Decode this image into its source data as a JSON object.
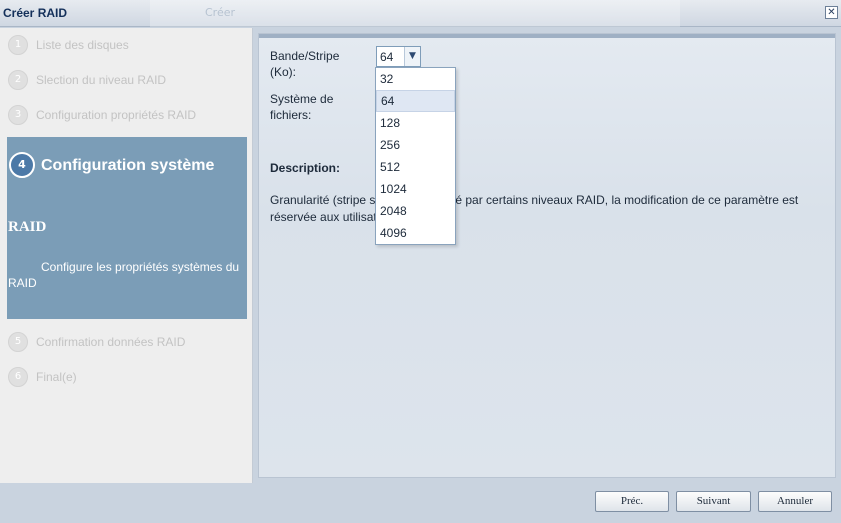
{
  "window": {
    "title": "Créer RAID",
    "background_label": "Créer",
    "close_glyph": "✕"
  },
  "steps": [
    {
      "number": "1",
      "label": "Liste des disques"
    },
    {
      "number": "2",
      "label": "Slection du niveau RAID"
    },
    {
      "number": "3",
      "label": "Configuration propriétés RAID"
    },
    {
      "number": "5",
      "label": "Confirmation données RAID"
    },
    {
      "number": "6",
      "label": "Final(e)"
    }
  ],
  "active_step": {
    "number": "4",
    "label_line1": "Configuration système",
    "label_line2": "RAID",
    "description": "Configure les propriétés systèmes du RAID"
  },
  "form": {
    "stripe_label_line1": "Bande/Stripe",
    "stripe_label_line2": "(Ko):",
    "stripe_value": "64",
    "fs_label_line1": "Système de",
    "fs_label_line2": "fichiers:",
    "stripe_options": [
      "32",
      "64",
      "128",
      "256",
      "512",
      "1024",
      "2048",
      "4096"
    ],
    "selected_option": "64"
  },
  "description": {
    "title": "Description:",
    "text_line1": "Granularité (stripe s",
    "text_line1_rest": "é par certains niveaux RAID, la modification de ce paramètre est",
    "text_line2": "réservée aux utilisat"
  },
  "buttons": {
    "prev": "Préc.",
    "next": "Suivant",
    "cancel": "Annuler"
  },
  "colors": {
    "active_step_bg": "#7b9db7",
    "active_number_bg": "#4c79a7",
    "window_title": "#14305a"
  },
  "icons": {
    "close": "close-icon",
    "combo_arrow": "chevron-down-icon"
  }
}
